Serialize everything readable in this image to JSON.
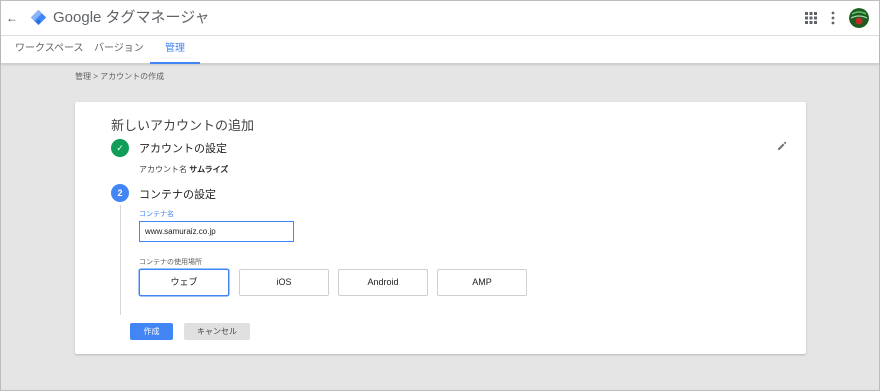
{
  "app": {
    "brand_google": "Google",
    "brand_product": "タグマネージャ",
    "back_glyph": "←"
  },
  "tabs": [
    {
      "label": "ワークスペース",
      "active": false
    },
    {
      "label": "バージョン",
      "active": false
    },
    {
      "label": "管理",
      "active": true
    }
  ],
  "breadcrumb": "管理 > アカウントの作成",
  "card": {
    "title": "新しいアカウントの追加",
    "step1": {
      "check_glyph": "✓",
      "title": "アカウントの設定",
      "account_label": "アカウント名",
      "account_value": "サムライズ"
    },
    "step2": {
      "number": "2",
      "title": "コンテナの設定",
      "container_name_label": "コンテナ名",
      "container_name_value": "www.samuraiz.co.jp",
      "usage_label": "コンテナの使用場所",
      "options": [
        "ウェブ",
        "iOS",
        "Android",
        "AMP"
      ],
      "selected": "ウェブ"
    },
    "create_label": "作成",
    "cancel_label": "キャンセル"
  },
  "colors": {
    "accent": "#4285f4",
    "success": "#0f9d58"
  }
}
